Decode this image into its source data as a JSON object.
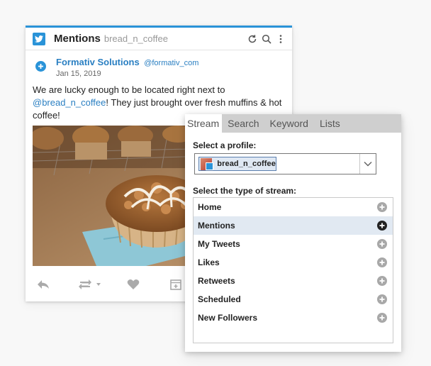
{
  "card": {
    "title": "Mentions",
    "subtitle": "bread_n_coffee",
    "author_name": "Formativ Solutions",
    "author_handle": "@formativ_com",
    "date": "Jan 15, 2019",
    "text_before": "We are lucky enough to be located right next to ",
    "mention": "@bread_n_coffee",
    "text_after": "! They just brought over fresh muffins & hot coffee!"
  },
  "panel": {
    "tabs": [
      {
        "label": "Stream",
        "active": true
      },
      {
        "label": "Search",
        "active": false
      },
      {
        "label": "Keyword",
        "active": false
      },
      {
        "label": "Lists",
        "active": false
      }
    ],
    "profile_label": "Select a profile:",
    "profile_value": "bread_n_coffee",
    "stream_type_label": "Select the type of stream:",
    "stream_types": [
      {
        "label": "Home",
        "selected": false
      },
      {
        "label": "Mentions",
        "selected": true
      },
      {
        "label": "My Tweets",
        "selected": false
      },
      {
        "label": "Likes",
        "selected": false
      },
      {
        "label": "Retweets",
        "selected": false
      },
      {
        "label": "Scheduled",
        "selected": false
      },
      {
        "label": "New Followers",
        "selected": false
      }
    ]
  },
  "colors": {
    "accent": "#2a93d8",
    "link": "#2a7fc2",
    "selected_row": "#e1e9f2"
  },
  "icons": {
    "header": [
      "twitter-icon",
      "refresh-icon",
      "search-icon",
      "more-vertical-icon"
    ],
    "actions": [
      "reply-icon",
      "retweet-icon",
      "like-icon",
      "schedule-icon"
    ]
  }
}
